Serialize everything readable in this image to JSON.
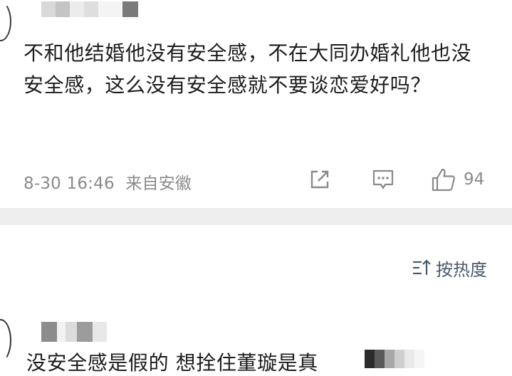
{
  "comment": {
    "text": "不和他结婚他没有安全感，不在大同办婚礼他也没安全感，这么没有安全感就不要谈恋爱好吗？",
    "timestamp": "8-30 16:46",
    "location": "来自安徽",
    "like_count": "94"
  },
  "sort": {
    "label": "按热度"
  },
  "next_comment": {
    "text": "没安全感是假的 想拴住董璇是真"
  },
  "colors": {
    "meta_gray": "#8a8a8a",
    "sort_color": "#4a5a6e",
    "divider": "#eeeeee"
  }
}
